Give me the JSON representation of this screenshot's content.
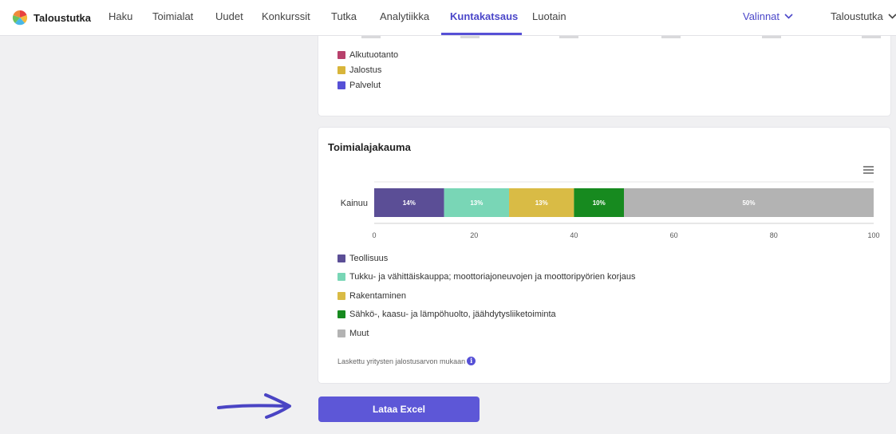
{
  "nav": {
    "brand": "Taloustutka",
    "items": [
      {
        "label": "Haku"
      },
      {
        "label": "Toimialat"
      },
      {
        "label": "Uudet"
      },
      {
        "label": "Konkurssit"
      },
      {
        "label": "Tutka"
      },
      {
        "label": "Analytiikka"
      },
      {
        "label": "Kuntakatsaus"
      },
      {
        "label": "Luotain"
      }
    ],
    "active": "Kuntakatsaus",
    "valinnat": "Valinnat",
    "user": "Taloustutka"
  },
  "top_card": {
    "legend": [
      {
        "label": "Alkutuotanto",
        "color": "#b8416c"
      },
      {
        "label": "Jalostus",
        "color": "#d8b53a"
      },
      {
        "label": "Palvelut",
        "color": "#5650d6"
      }
    ]
  },
  "industry_card": {
    "title": "Toimialajakauma",
    "menu_icon": "hamburger-menu-icon",
    "footnote": "Laskettu yritysten jalostusarvon mukaan",
    "info_icon": "info-icon"
  },
  "chart_data": {
    "type": "bar",
    "orientation": "horizontal",
    "stacked": true,
    "categories": [
      "Kainuu"
    ],
    "series": [
      {
        "name": "Teollisuus",
        "values": [
          14
        ],
        "label": "14%",
        "color": "#5b4e96"
      },
      {
        "name": "Tukku- ja vähittäiskauppa; moottoriajoneuvojen ja moottoripyörien korjaus",
        "values": [
          13
        ],
        "label": "13%",
        "color": "#79d6b6"
      },
      {
        "name": "Rakentaminen",
        "values": [
          13
        ],
        "label": "13%",
        "color": "#d9bb45"
      },
      {
        "name": "Sähkö-, kaasu- ja lämpöhuolto, jäähdytysliiketoiminta",
        "values": [
          10
        ],
        "label": "10%",
        "color": "#178a1f"
      },
      {
        "name": "Muut",
        "values": [
          50
        ],
        "label": "50%",
        "color": "#b3b3b3"
      }
    ],
    "xlim": [
      0,
      100
    ],
    "xticks": [
      0,
      20,
      40,
      60,
      80,
      100
    ],
    "legend_position": "bottom"
  },
  "export": {
    "label": "Lataa Excel",
    "arrow_icon": "arrow-right-icon",
    "arrow_color": "#4a44c4"
  }
}
